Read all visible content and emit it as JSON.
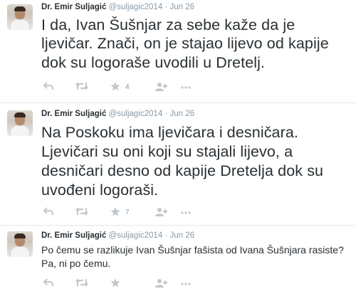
{
  "tweets": [
    {
      "name": "Dr. Emir Suljagić",
      "handle": "@suljagic2014",
      "separator": "·",
      "time": "Jun 26",
      "lines": [
        "I da, Ivan Šušnjar za sebe kaže da je",
        "ljevičar. Znači, on je stajao lijevo od kapije",
        "dok su logoraše uvodili u Dretelj."
      ],
      "favorites": "4"
    },
    {
      "name": "Dr. Emir Suljagić",
      "handle": "@suljagic2014",
      "separator": "·",
      "time": "Jun 26",
      "lines": [
        "Na Poskoku ima ljevičara i desničara.",
        "Ljevičari su oni koji su stajali lijevo, a",
        "desničari desno od kapije Dretelja dok su",
        "uvođeni logoraši."
      ],
      "favorites": "7"
    },
    {
      "name": "Dr. Emir Suljagić",
      "handle": "@suljagic2014",
      "separator": "·",
      "time": "Jun 26",
      "lines": [
        "Po čemu se razlikuje Ivan Šušnjar fašista od Ivana Šušnjara rasiste?",
        "Pa, ni po čemu."
      ],
      "favorites": ""
    }
  ],
  "icons": [
    "reply-icon",
    "retweet-icon",
    "favorite-star-icon",
    "follow-person-icon",
    "more-dots-icon"
  ],
  "colors": {
    "text": "#292f33",
    "meta": "#8899a6",
    "icon": "#c0c7cd",
    "divider": "#e1e8ed"
  }
}
